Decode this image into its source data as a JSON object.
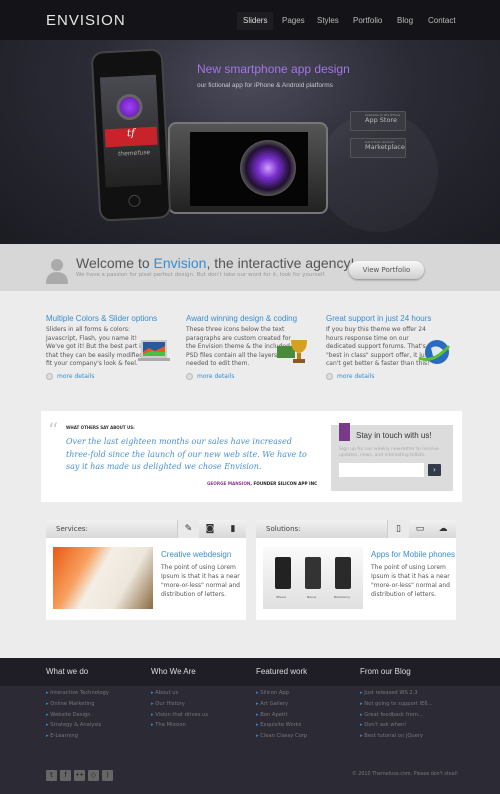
{
  "nav": {
    "logo": "ENVISION",
    "items": [
      "Sliders",
      "Pages",
      "Styles",
      "Portfolio",
      "Blog",
      "Contact"
    ],
    "active": "Sliders"
  },
  "hero": {
    "title": "New smartphone app design",
    "subtitle": "our fictional app for iPhone & Android platforms",
    "app_brand": "tf",
    "app_name": "themefuse",
    "stores": [
      {
        "small": "Available on the iPhone",
        "label": "App Store"
      },
      {
        "small": "Get it from Android",
        "label": "Marketplace"
      }
    ]
  },
  "welcome": {
    "title_pre": "Welcome to ",
    "title_brand": "Envision",
    "title_post": ", the interactive agency!",
    "subtitle": "We have a passion for pixel perfect design. But don't take our word for it, look for yourself.",
    "button": "View Portfolio"
  },
  "features": [
    {
      "title": "Multiple Colors & Slider options",
      "text": "Sliders in all forms & colors: Javascript, Flash, you name it! We've got it! But the best part is that they can be easily modified to fit your company's look & feel.",
      "more": "more details",
      "icon": "laptop-chart-icon"
    },
    {
      "title": "Award winning design & coding",
      "text": "These three icons below the text paragraphs are custom created for the Envision theme & the included PSD files contain all the layers needed to edit them.",
      "more": "more details",
      "icon": "trophy-icon"
    },
    {
      "title": "Great support in just 24 hours",
      "text": "If you buy this theme we offer 24 hours response time on our dedicated support forums. That's \"best in class\" support offer, it just can't get better & faster than this!",
      "more": "more details",
      "icon": "globe-icon"
    }
  ],
  "testimonial": {
    "label": "WHAT OTHERS SAY ABOUT US:",
    "quote": "Over the last eighteen months our sales have increased three-fold since the launch of our new web site. We have to say it has made us delighted we chose Envision.",
    "author": "GEORGE MANSION",
    "role": ", FOUNDER SILICON APP INC"
  },
  "newsletter": {
    "title": "Stay in touch with us!",
    "text": "Sign up for our weekly newsletter to receive updates, news, and interesting tidbits.",
    "input_value": "",
    "submit": "›"
  },
  "boxes": [
    {
      "label": "Services:",
      "tabs": [
        "brush-icon",
        "camera-icon",
        "bar-chart-icon"
      ],
      "title": "Creative webdesign",
      "text": "The point of using Lorem Ipsum is that it has a near \"more-or-less\" normal and distribution of letters."
    },
    {
      "label": "Solutions:",
      "tabs": [
        "phone-icon",
        "monitor-icon",
        "cloud-icon"
      ],
      "title": "Apps for Mobile phones",
      "text": "The point of using Lorem Ipsum is that it has a near \"more-or-less\" normal and distribution of letters.",
      "phones": [
        "iPhone",
        "Nexus",
        "Blackberry"
      ]
    }
  ],
  "footer": {
    "columns": [
      {
        "title": "What we do",
        "items": [
          "Interactive Technology",
          "Online Marketing",
          "Website Design",
          "Strategy & Analysis",
          "E-Learning"
        ]
      },
      {
        "title": "Who We Are",
        "items": [
          "About us",
          "Our History",
          "Vision that drives us",
          "The Mission"
        ]
      },
      {
        "title": "Featured work",
        "items": [
          "Silicon App",
          "Art Gallery",
          "Bon Apetit",
          "Exquisite Works",
          "Clean Classy Corp"
        ]
      },
      {
        "title": "From our Blog",
        "items": [
          "Just released WS 2.3",
          "Not going to support IE6...",
          "Great feedback from...",
          "Don't ask when!",
          "Best tutorial on jQuery"
        ]
      }
    ],
    "social": [
      "twitter-icon",
      "facebook-icon",
      "flickr-icon",
      "delicious-icon",
      "rss-icon"
    ],
    "copyright": "© 2010 Themefuse.com. Please don't steal!"
  },
  "colors": {
    "accent": "#3a8dcf",
    "hero_title": "#a575e6",
    "ribbon": "#c8222a"
  }
}
